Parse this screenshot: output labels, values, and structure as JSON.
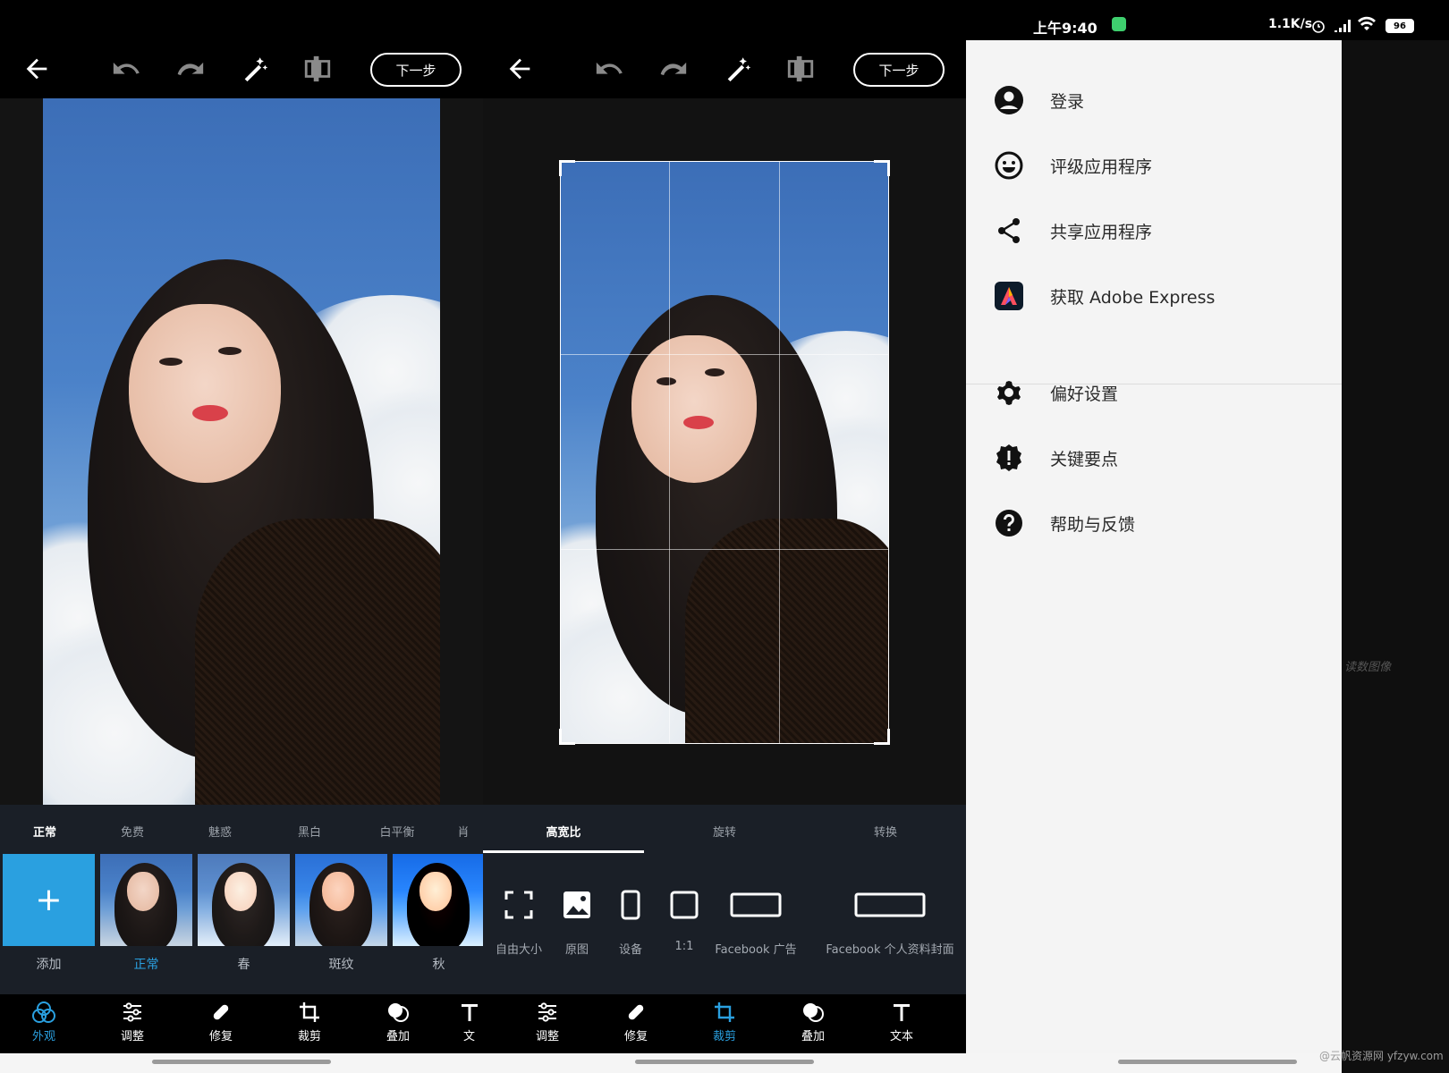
{
  "editor": {
    "next_label": "下一步",
    "filter_tabs": [
      "正常",
      "免费",
      "魅惑",
      "黑白",
      "白平衡",
      "肖"
    ],
    "thumbnails": [
      "添加",
      "正常",
      "春",
      "斑纹",
      "秋"
    ],
    "add_symbol": "+",
    "tools": [
      "外观",
      "调整",
      "修复",
      "裁剪",
      "叠加",
      "文"
    ]
  },
  "crop": {
    "next_label": "下一步",
    "tabs": [
      "高宽比",
      "旋转",
      "转换"
    ],
    "aspects": [
      "自由大小",
      "原图",
      "设备",
      "1:1",
      "Facebook 广告",
      "Facebook 个人资料封面"
    ],
    "tools": [
      "调整",
      "修复",
      "裁剪",
      "叠加",
      "文本"
    ]
  },
  "status": {
    "time": "上午9:40",
    "speed": "1.1K/s",
    "battery": "96"
  },
  "drawer": {
    "items": [
      {
        "label": "登录",
        "icon": "account-icon"
      },
      {
        "label": "评级应用程序",
        "icon": "smiley-icon"
      },
      {
        "label": "共享应用程序",
        "icon": "share-icon"
      },
      {
        "label": "获取 Adobe Express",
        "icon": "adobe-express-icon"
      },
      {
        "label": "偏好设置",
        "icon": "gear-icon"
      },
      {
        "label": "关键要点",
        "icon": "badge-alert-icon"
      },
      {
        "label": "帮助与反馈",
        "icon": "help-icon"
      }
    ]
  },
  "watermarks": {
    "side": "读数图像",
    "corner": "@云帆资源网 yfzyw.com"
  },
  "colors": {
    "accent": "#2aa0e0",
    "toolbar": "#000000",
    "drawer_bg": "#f4f4f4"
  }
}
